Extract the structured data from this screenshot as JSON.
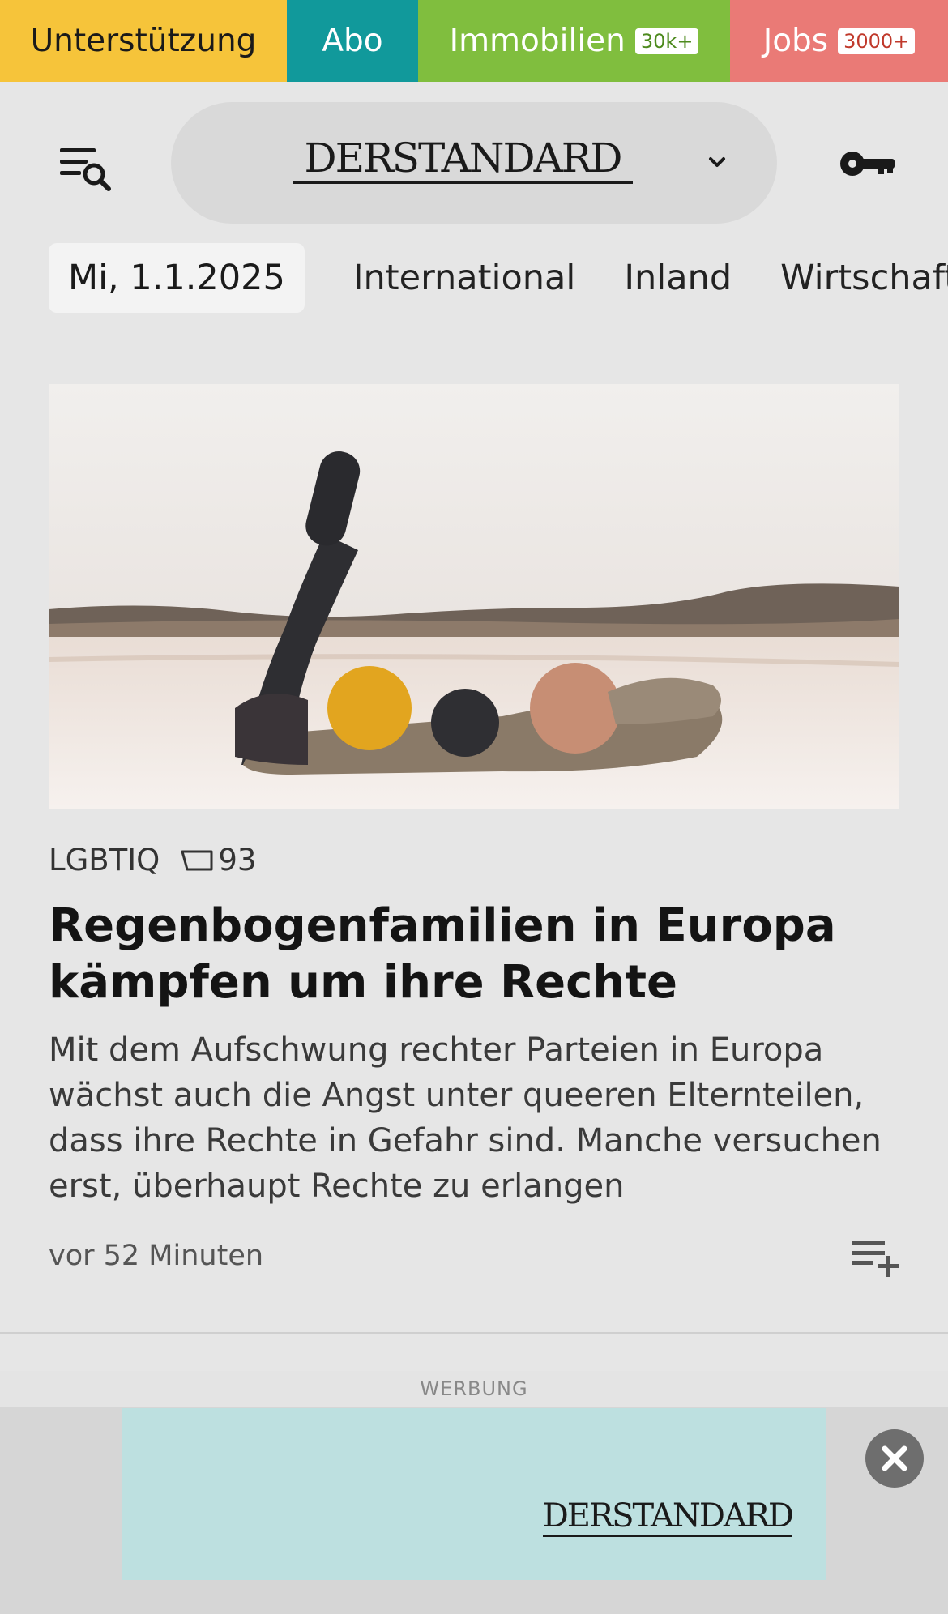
{
  "topbar": {
    "support": "Unterstützung",
    "abo": "Abo",
    "immobilien": "Immobilien",
    "immobilien_badge": "30k+",
    "jobs": "Jobs",
    "jobs_badge": "3000+"
  },
  "header": {
    "logo": "DERSTANDARD"
  },
  "nav": {
    "date": "Mi, 1.1.2025",
    "items": [
      "International",
      "Inland",
      "Wirtschaft"
    ]
  },
  "article": {
    "category": "LGBTIQ",
    "comments": "93",
    "headline": "Regenbogenfamilien in Europa kämpfen um ihre Rechte",
    "teaser": "Mit dem Aufschwung rechter Parteien in Europa wächst auch die Angst unter queeren Elternteilen, dass ihre Rechte in Gefahr sind. Manche versuchen erst, überhaupt Rechte zu erlangen",
    "time": "vor 52 Minuten"
  },
  "ad": {
    "label": "WERBUNG",
    "logo": "DERSTANDARD"
  },
  "colors": {
    "support": "#f6c43a",
    "abo": "#11999b",
    "immobilien": "#80be3e",
    "jobs": "#ea7a76",
    "background": "#e6e6e6",
    "ad_banner": "#bde0e0"
  },
  "icons": [
    "menu-search-icon",
    "chevron-down-icon",
    "key-icon",
    "comment-icon",
    "playlist-add-icon",
    "close-icon"
  ]
}
